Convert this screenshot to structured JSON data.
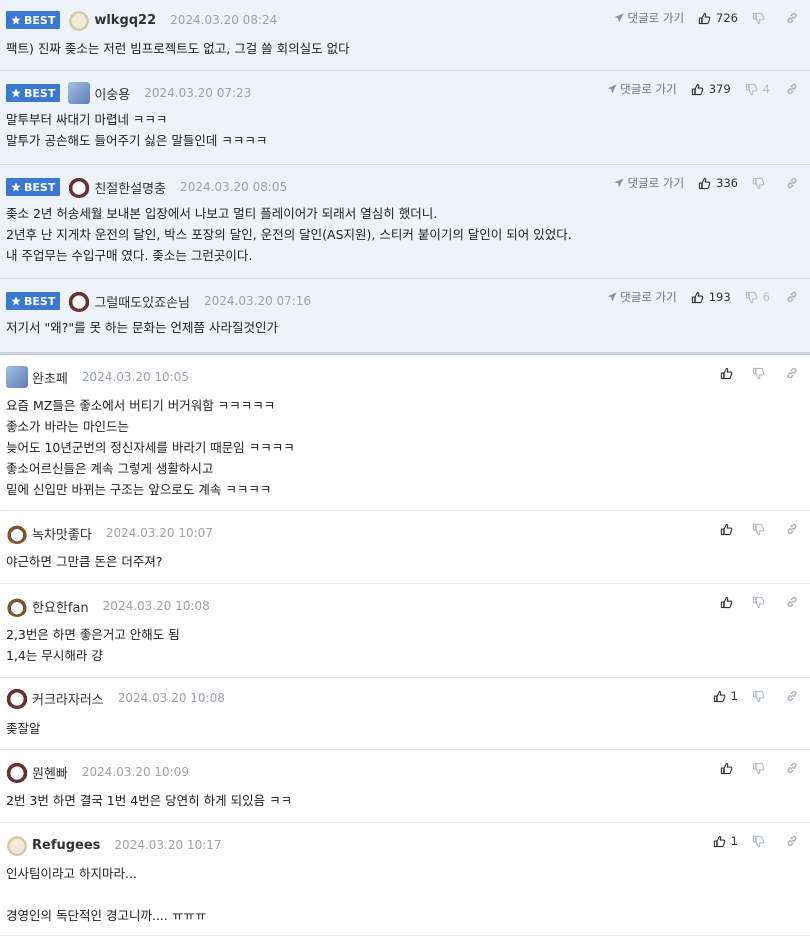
{
  "labels": {
    "best": "BEST",
    "goto": "댓글로 가기"
  },
  "comments": [
    {
      "best": true,
      "avatar": "puppy-avatar",
      "nick": "wlkgq22",
      "nick_bold": true,
      "date": "2024.03.20 08:24",
      "likes": "726",
      "dislikes": "",
      "body": "팩트) 진짜 좆소는 저런 빔프로젝트도 없고, 그걸 쓸 회의실도 없다"
    },
    {
      "best": true,
      "avatar": "blue-avatar",
      "nick": "이숭용",
      "nick_bold": false,
      "date": "2024.03.20 07:23",
      "likes": "379",
      "dislikes": "4",
      "body": "말투부터 싸대기 마렵네 ㅋㅋㅋ\n말투가 공손해도 들어주기 싫은 말들인데 ㅋㅋㅋㅋ"
    },
    {
      "best": true,
      "avatar": "panda-avatar",
      "nick": "친절한설명충",
      "nick_bold": false,
      "date": "2024.03.20 08:05",
      "likes": "336",
      "dislikes": "",
      "body": "좆소 2년 허송세월 보내본 입장에서 나보고 멀티 플레이어가 되래서 열심히 했더니.\n2년후 난 지게차 운전의 달인, 박스 포장의 달인, 운전의 달인(AS지원), 스티커 붙이기의 달인이 되어 있었다.\n내 주업무는 수입구매 였다. 좆소는 그런곳이다."
    },
    {
      "best": true,
      "avatar": "panda-avatar",
      "nick": "그럴때도있죠손님",
      "nick_bold": false,
      "date": "2024.03.20 07:16",
      "likes": "193",
      "dislikes": "6",
      "body": "저기서 \"왜?\"를 못 하는 문화는 언제쯤 사라질것인가"
    },
    {
      "best": false,
      "avatar": "blue-avatar",
      "nick": "완초페",
      "nick_bold": false,
      "date": "2024.03.20 10:05",
      "likes": "",
      "dislikes": "",
      "body": "요즘 MZ들은 좋소에서 버티기 버거워함 ㅋㅋㅋㅋㅋ\n좋소가 바라는 마인드는\n늦어도 10년군번의 정신자세를 바라기 때문임 ㅋㅋㅋㅋ\n좋소어르신들은 계속 그렇게 생활하시고\n밑에 신입만 바뀌는 구조는 앞으로도 계속 ㅋㅋㅋㅋ"
    },
    {
      "best": false,
      "avatar": "fox-avatar",
      "nick": "녹차맛좋다",
      "nick_bold": false,
      "date": "2024.03.20 10:07",
      "likes": "",
      "dislikes": "",
      "body": "야근하면 그만큼 돈은 더주져?"
    },
    {
      "best": false,
      "avatar": "fox-avatar",
      "nick": "한요한fan",
      "nick_bold": false,
      "date": "2024.03.20 10:08",
      "likes": "",
      "dislikes": "",
      "body": "2,3번은 하면 좋은거고 안해도 됨\n1,4는 무시해라 걍"
    },
    {
      "best": false,
      "avatar": "panda-avatar",
      "nick": "커크라자러스",
      "nick_bold": false,
      "date": "2024.03.20 10:08",
      "likes": "1",
      "dislikes": "",
      "body": "좆잘알"
    },
    {
      "best": false,
      "avatar": "panda-avatar",
      "nick": "뭔헨빠",
      "nick_bold": false,
      "date": "2024.03.20 10:09",
      "likes": "",
      "dislikes": "",
      "body": "2번 3번 하면 결국 1번 4번은 당연히 하게 되있음 ㅋㅋ"
    },
    {
      "best": false,
      "avatar": "puppy-avatar",
      "nick": "Refugees",
      "nick_bold": true,
      "date": "2024.03.20 10:17",
      "likes": "1",
      "dislikes": "",
      "body": "인사팀이라고 하지마라...\n\n경영인의 독단적인 경고니까.... ㅠㅠㅠ"
    }
  ]
}
